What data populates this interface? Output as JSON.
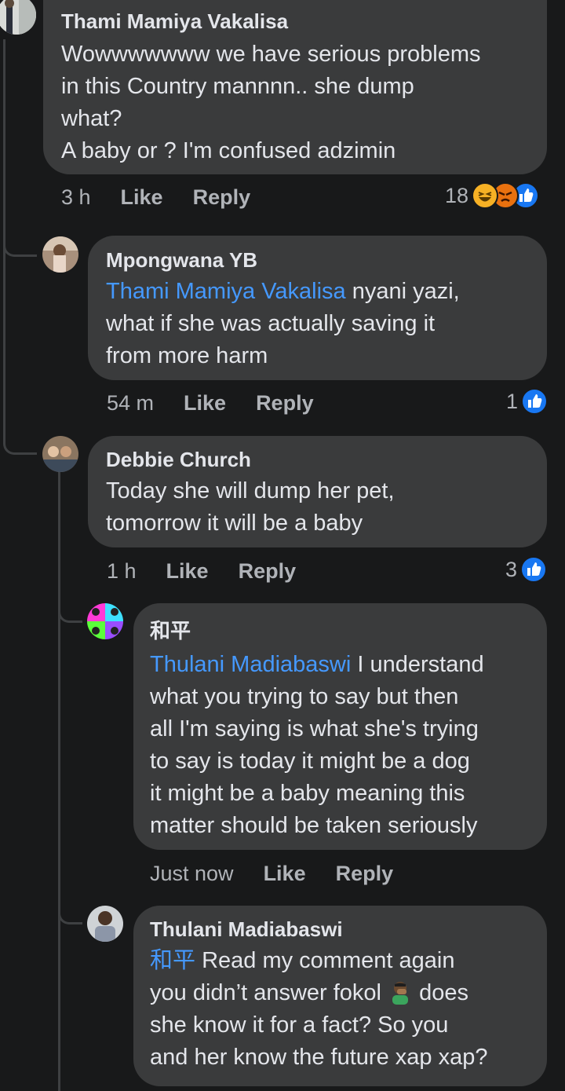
{
  "comments": [
    {
      "author": "Thami Mamiya Vakalisa",
      "lines": [
        "Wowwwwwww we have serious problems",
        "in this Country mannnn.. she dump",
        "what?",
        "A baby or ? I'm confused adzimin"
      ],
      "time": "3 h",
      "like": "Like",
      "reply": "Reply",
      "reaction_count": "18",
      "reactions": [
        "haha-icon",
        "angry-icon",
        "like-icon"
      ]
    },
    {
      "author": "Mpongwana YB",
      "mention": "Thami Mamiya Vakalisa",
      "lines": [
        " nyani yazi,",
        "what if she was actually saving it",
        "from more harm"
      ],
      "time": "54 m",
      "like": "Like",
      "reply": "Reply",
      "reaction_count": "1",
      "reactions": [
        "like-icon"
      ]
    },
    {
      "author": "Debbie Church",
      "lines": [
        "Today she will dump her pet,",
        "tomorrow it will be a baby"
      ],
      "time": "1 h",
      "like": "Like",
      "reply": "Reply",
      "reaction_count": "3",
      "reactions": [
        "like-icon"
      ]
    },
    {
      "author": "和平",
      "mention": "Thulani Madiabaswi",
      "lines": [
        " I understand",
        "what you trying to say but then",
        "all I'm saying is what she's trying",
        "to say is today it might be a dog",
        "it might be a baby meaning this",
        "matter should be taken seriously"
      ],
      "time": "Just now",
      "like": "Like",
      "reply": "Reply"
    },
    {
      "author": "Thulani Madiabaswi",
      "mention": "和平",
      "lines": [
        " Read my comment again",
        "you didn’t answer fokol ",
        " does",
        "she know it for a fact?  So you",
        "and her know the future xap xap?"
      ],
      "inline_emoji": "facepalm-icon"
    }
  ],
  "colors": {
    "background": "#18191a",
    "bubble": "#3a3b3c",
    "mention": "#4599ff",
    "like_blue": "#1877f2"
  }
}
